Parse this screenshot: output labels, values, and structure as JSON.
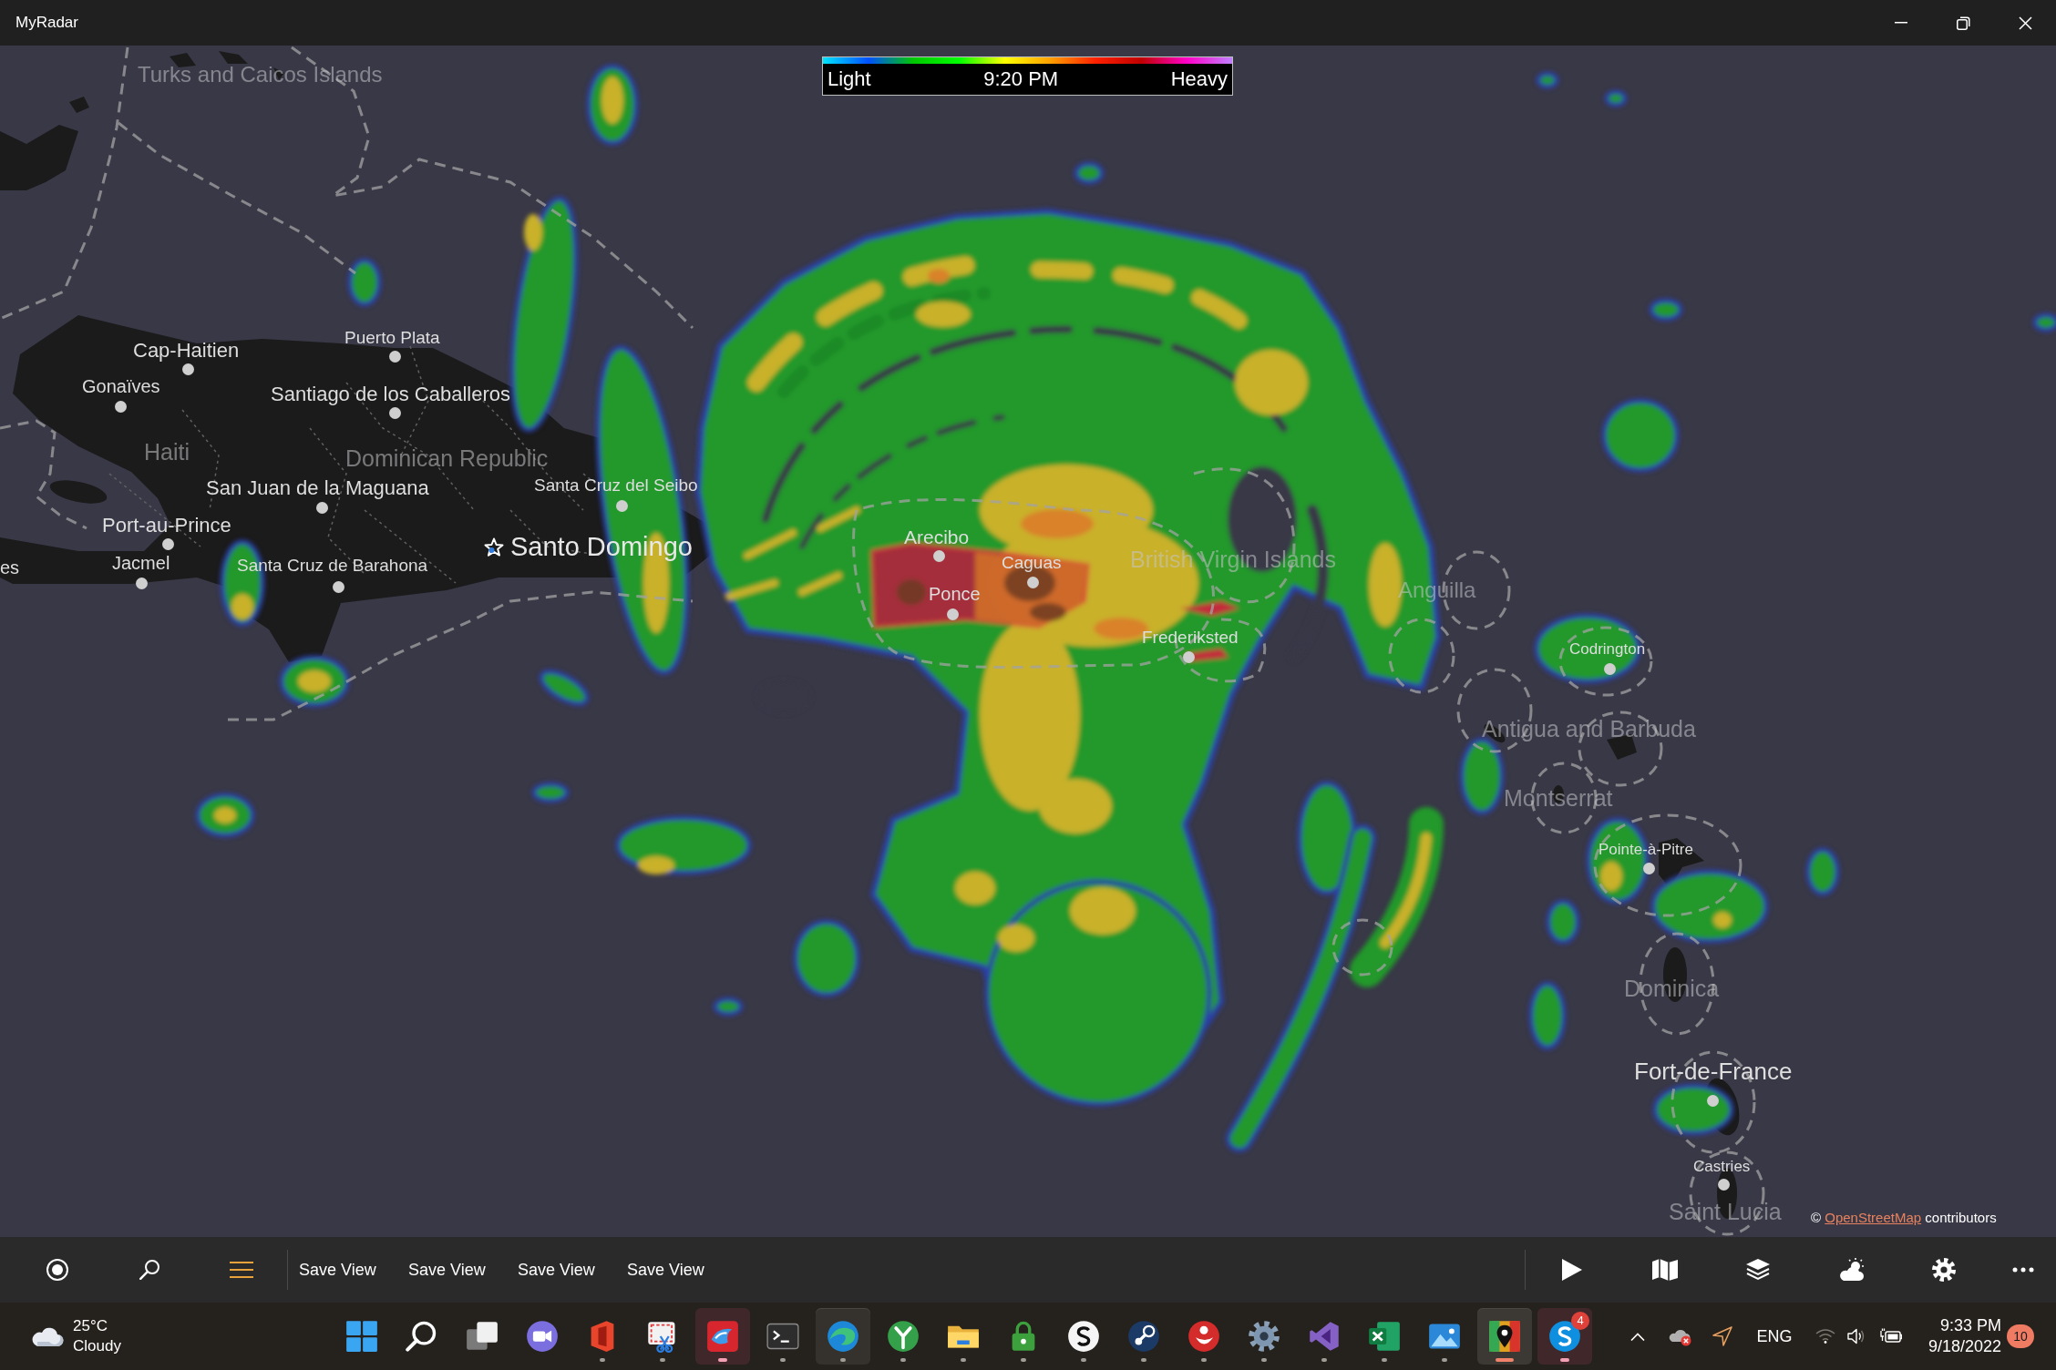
{
  "window": {
    "title": "MyRadar"
  },
  "legend": {
    "low_label": "Light",
    "time": "9:20 PM",
    "high_label": "Heavy"
  },
  "map": {
    "labels": [
      {
        "text": "Turks and Caicos Islands",
        "kind": "region"
      },
      {
        "text": "Puerto Plata",
        "kind": "city"
      },
      {
        "text": "Cap-Haitien",
        "kind": "city"
      },
      {
        "text": "Gonaïves",
        "kind": "city"
      },
      {
        "text": "Santiago de los Caballeros",
        "kind": "city"
      },
      {
        "text": "Haiti",
        "kind": "region"
      },
      {
        "text": "Dominican Republic",
        "kind": "region"
      },
      {
        "text": "San Juan de la Maguana",
        "kind": "city"
      },
      {
        "text": "Santa Cruz del Seibo",
        "kind": "city"
      },
      {
        "text": "Port-au-Prince",
        "kind": "city"
      },
      {
        "text": "Santo Domingo",
        "kind": "capital"
      },
      {
        "text": "Arecibo",
        "kind": "city"
      },
      {
        "text": "es",
        "kind": "city"
      },
      {
        "text": "Jacmel",
        "kind": "city"
      },
      {
        "text": "Santa Cruz de Barahona",
        "kind": "city"
      },
      {
        "text": "Caguas",
        "kind": "city"
      },
      {
        "text": "British Virgin Islands",
        "kind": "region"
      },
      {
        "text": "Ponce",
        "kind": "city"
      },
      {
        "text": "Anguilla",
        "kind": "region"
      },
      {
        "text": "Frederiksted",
        "kind": "city"
      },
      {
        "text": "Codrington",
        "kind": "city"
      },
      {
        "text": "Antigua and Barbuda",
        "kind": "region"
      },
      {
        "text": "Montserrat",
        "kind": "region"
      },
      {
        "text": "Pointe-à-Pitre",
        "kind": "city"
      },
      {
        "text": "Dominica",
        "kind": "region"
      },
      {
        "text": "Fort-de-France",
        "kind": "city"
      },
      {
        "text": "Castries",
        "kind": "city"
      },
      {
        "text": "Saint Lucia",
        "kind": "region"
      }
    ],
    "attribution": {
      "prefix": "©",
      "link": "OpenStreetMap",
      "suffix": "contributors"
    }
  },
  "app_bar": {
    "tools": [
      {
        "kind": "locate",
        "selected": false
      },
      {
        "kind": "search",
        "selected": false
      },
      {
        "kind": "menu",
        "selected": true
      }
    ],
    "saved_views": [
      "Save View",
      "Save View",
      "Save View",
      "Save View"
    ],
    "actions": [
      {
        "kind": "play"
      },
      {
        "kind": "map"
      },
      {
        "kind": "layers"
      },
      {
        "kind": "weather"
      },
      {
        "kind": "settings"
      },
      {
        "kind": "more"
      }
    ]
  },
  "taskbar": {
    "weather": {
      "temperature": "25°C",
      "condition": "Cloudy"
    },
    "apps": [
      {
        "kind": "start",
        "running": false,
        "active": false,
        "highlighted": false,
        "attention": false
      },
      {
        "kind": "search",
        "running": false,
        "active": false,
        "highlighted": false,
        "attention": false
      },
      {
        "kind": "task-view",
        "running": false,
        "active": false,
        "highlighted": false,
        "attention": false
      },
      {
        "kind": "video-call",
        "running": false,
        "active": false,
        "highlighted": false,
        "attention": false
      },
      {
        "kind": "office",
        "running": true,
        "active": false,
        "highlighted": false,
        "attention": false
      },
      {
        "kind": "snip",
        "running": true,
        "active": false,
        "highlighted": false,
        "attention": false
      },
      {
        "kind": "bird",
        "running": true,
        "active": false,
        "highlighted": false,
        "attention": true
      },
      {
        "kind": "terminal",
        "running": true,
        "active": false,
        "highlighted": false,
        "attention": false
      },
      {
        "kind": "browser",
        "running": true,
        "active": false,
        "highlighted": true,
        "attention": false
      },
      {
        "kind": "tree",
        "running": true,
        "active": false,
        "highlighted": false,
        "attention": false
      },
      {
        "kind": "folder",
        "running": true,
        "active": false,
        "highlighted": false,
        "attention": false
      },
      {
        "kind": "lock",
        "running": true,
        "active": false,
        "highlighted": false,
        "attention": false
      },
      {
        "kind": "letter-s",
        "running": true,
        "active": false,
        "highlighted": false,
        "attention": false
      },
      {
        "kind": "steam",
        "running": true,
        "active": false,
        "highlighted": false,
        "attention": false
      },
      {
        "kind": "character",
        "running": true,
        "active": false,
        "highlighted": false,
        "attention": false
      },
      {
        "kind": "settings",
        "running": true,
        "active": false,
        "highlighted": false,
        "attention": false
      },
      {
        "kind": "code",
        "running": true,
        "active": false,
        "highlighted": false,
        "attention": false
      },
      {
        "kind": "spreadsheet",
        "running": true,
        "active": false,
        "highlighted": false,
        "attention": false
      },
      {
        "kind": "photos",
        "running": true,
        "active": false,
        "highlighted": false,
        "attention": false
      },
      {
        "kind": "radar",
        "running": true,
        "active": true,
        "highlighted": true,
        "attention": false
      },
      {
        "kind": "messenger",
        "running": true,
        "active": false,
        "highlighted": false,
        "attention": true,
        "badge": "4"
      }
    ],
    "tray": {
      "language": "ENG",
      "time": "9:33 PM",
      "date": "9/18/2022",
      "notifications": "10"
    }
  }
}
